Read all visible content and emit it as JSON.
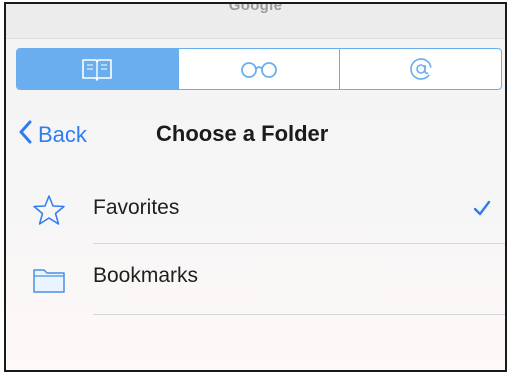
{
  "topbar": {
    "title": "Google"
  },
  "tabs": [
    {
      "icon": "book-icon",
      "active": true
    },
    {
      "icon": "glasses-icon",
      "active": false
    },
    {
      "icon": "at-sign-icon",
      "active": false
    }
  ],
  "nav": {
    "back_label": "Back",
    "title": "Choose a Folder"
  },
  "folders": [
    {
      "icon": "star-icon",
      "label": "Favorites",
      "selected": true
    },
    {
      "icon": "folder-icon",
      "label": "Bookmarks",
      "selected": false
    }
  ],
  "colors": {
    "accent": "#2f7cf0",
    "segment": "#6aaef0"
  }
}
